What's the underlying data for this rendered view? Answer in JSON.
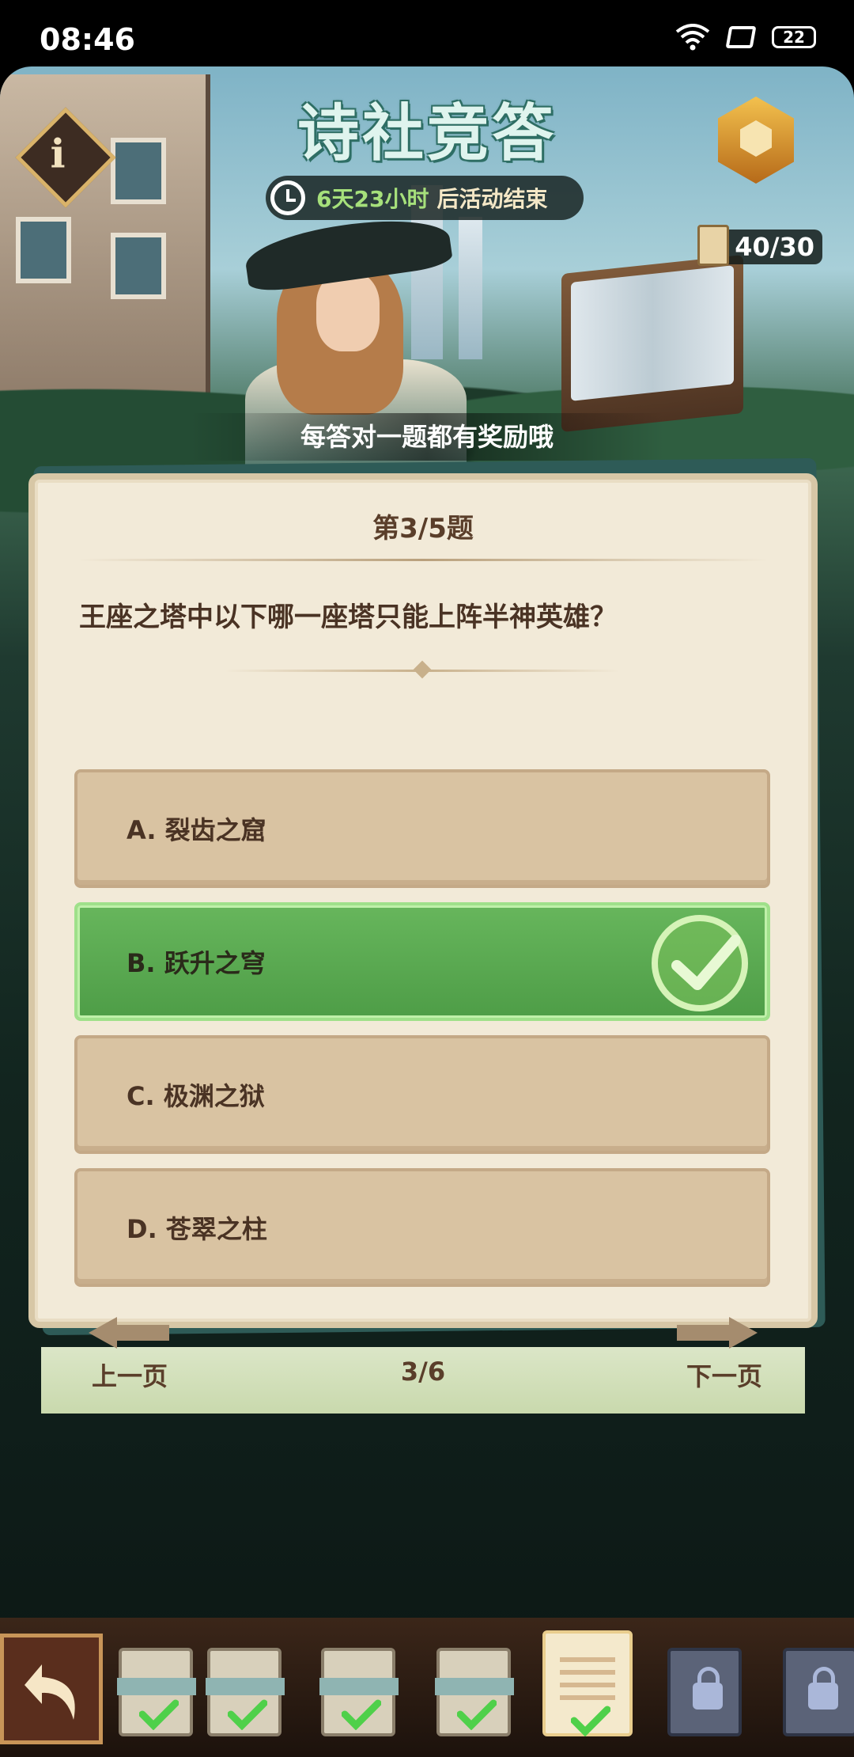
{
  "status_bar": {
    "time": "08:46",
    "battery": "22"
  },
  "header": {
    "title": "诗社竞答",
    "timer_days": "6天23小时",
    "timer_suffix": "后活动结束",
    "progress_count": "40/30",
    "reward_hint": "每答对一题都有奖励哦"
  },
  "quiz": {
    "question_number": "第3/5题",
    "question": "王座之塔中以下哪一座塔只能上阵半神英雄？",
    "options": [
      {
        "label": "A. 裂齿之窟",
        "state": "normal"
      },
      {
        "label": "B. 跃升之穹",
        "state": "correct"
      },
      {
        "label": "C. 极渊之狱",
        "state": "normal"
      },
      {
        "label": "D. 苍翠之柱",
        "state": "normal"
      }
    ],
    "prev_label": "上一页",
    "page_indicator": "3/6",
    "next_label": "下一页"
  },
  "bottom_bar": {
    "cards": [
      {
        "state": "completed"
      },
      {
        "state": "completed"
      },
      {
        "state": "completed"
      },
      {
        "state": "completed"
      },
      {
        "state": "current-completed"
      },
      {
        "state": "locked"
      },
      {
        "state": "locked"
      }
    ]
  },
  "colors": {
    "correct": "#5aaa50",
    "accent_green": "#a6e07b",
    "card_bg": "#f2ead8",
    "option_bg": "#d9c3a2"
  }
}
